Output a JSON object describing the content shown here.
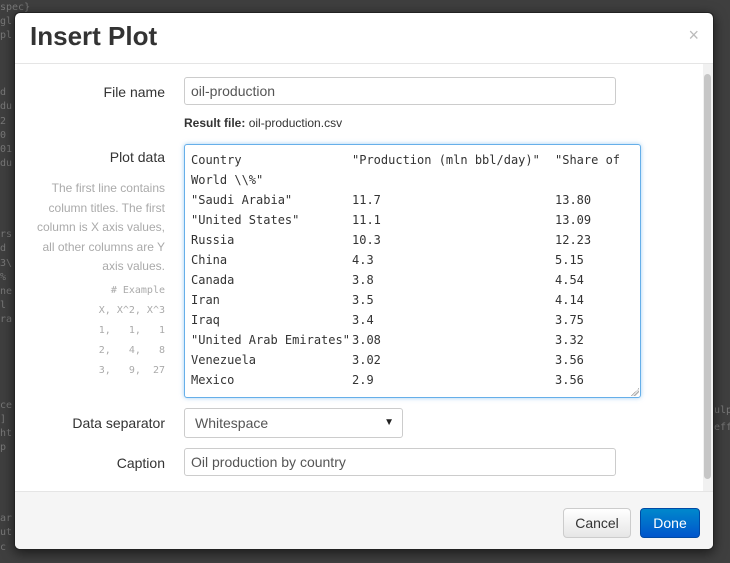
{
  "background": {
    "left_lines": [
      "spec}",
      "gl",
      "pl",
      "",
      "",
      "",
      "d",
      "du",
      "2",
      "0",
      "01",
      "du",
      "",
      "",
      "",
      "",
      "rs",
      "d",
      "3\\",
      "%",
      "ne",
      "l",
      "ra",
      "",
      "",
      "",
      "",
      "",
      "ce",
      "]",
      "ht",
      "p",
      "",
      "",
      "",
      "",
      "ar",
      "ut",
      "c"
    ],
    "right_lines": [
      "ulp",
      "eff"
    ]
  },
  "dialog": {
    "title": "Insert Plot",
    "close_glyph": "×",
    "file_name_label": "File name",
    "file_name_value": "oil-production",
    "result_file_label": "Result file:",
    "result_file_value": "oil-production.csv",
    "plot_data_label": "Plot data",
    "help_text": "The first line contains column titles. The first column is X axis values, all other columns are Y axis values.",
    "example_text": "# Example\nX, X^2, X^3\n1,   1,   1\n2,   4,   8\n3,   9,  27",
    "plot_data_rows": [
      [
        "Country",
        "\"Production (mln bbl/day)\"",
        "\"Share of"
      ],
      [
        "World \\\\%\"",
        "",
        ""
      ],
      [
        "\"Saudi Arabia\"",
        "11.7",
        "13.80"
      ],
      [
        "\"United States\"",
        "11.1",
        "13.09"
      ],
      [
        "Russia",
        "10.3",
        "12.23"
      ],
      [
        "China",
        "4.3",
        "5.15"
      ],
      [
        "Canada",
        "3.8",
        "4.54"
      ],
      [
        "Iran",
        "3.5",
        "4.14"
      ],
      [
        "Iraq",
        "3.4",
        "3.75"
      ],
      [
        "\"United Arab Emirates\"",
        "3.08",
        "3.32"
      ],
      [
        "Venezuela",
        "3.02",
        "3.56"
      ],
      [
        "Mexico",
        "2.9",
        "3.56"
      ]
    ],
    "separator_label": "Data separator",
    "separator_value": "Whitespace",
    "caption_label": "Caption",
    "caption_value": "Oil production by country",
    "cancel_label": "Cancel",
    "done_label": "Done"
  }
}
